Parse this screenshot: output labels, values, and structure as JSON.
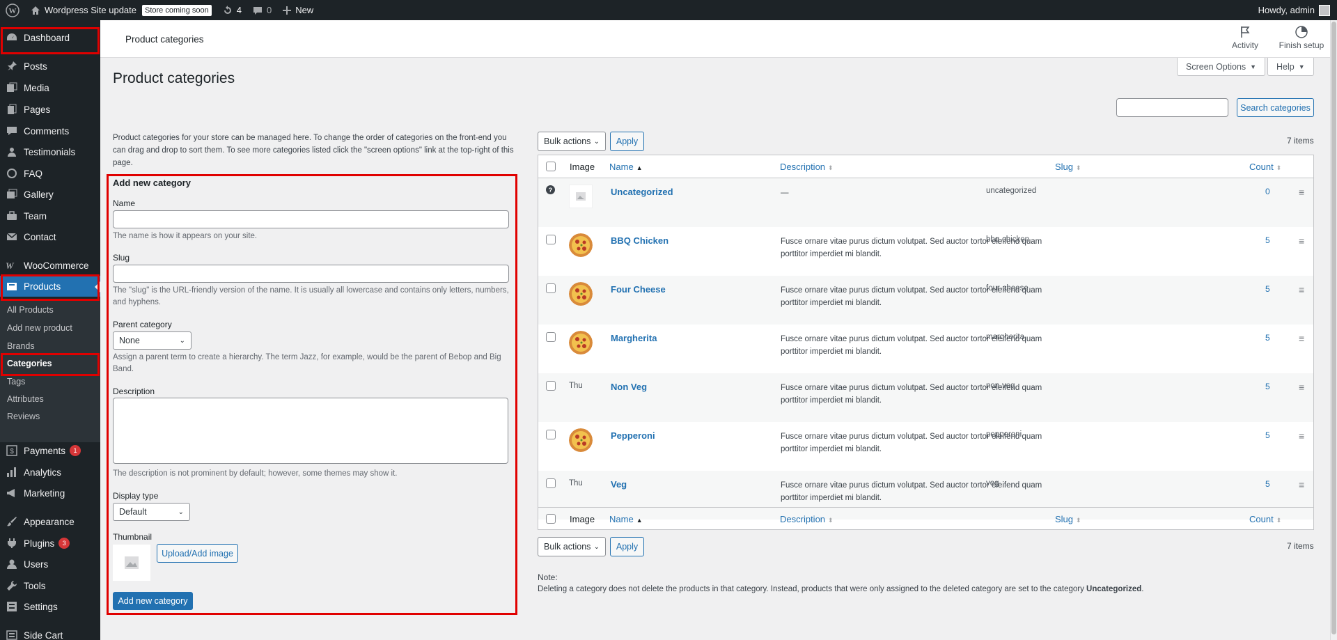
{
  "adminbar": {
    "site_name": "Wordpress Site update",
    "store_badge": "Store coming soon",
    "updates_count": "4",
    "comments_count": "0",
    "new_label": "New",
    "howdy": "Howdy, admin"
  },
  "sidebar": {
    "dashboard": "Dashboard",
    "posts": "Posts",
    "media": "Media",
    "pages": "Pages",
    "comments": "Comments",
    "testimonials": "Testimonials",
    "faq": "FAQ",
    "gallery": "Gallery",
    "team": "Team",
    "contact": "Contact",
    "woocommerce": "WooCommerce",
    "products": "Products",
    "sub": {
      "all_products": "All Products",
      "add_new_product": "Add new product",
      "brands": "Brands",
      "categories": "Categories",
      "tags": "Tags",
      "attributes": "Attributes",
      "reviews": "Reviews"
    },
    "payments": "Payments",
    "payments_badge": "1",
    "analytics": "Analytics",
    "marketing": "Marketing",
    "appearance": "Appearance",
    "plugins": "Plugins",
    "plugins_badge": "3",
    "users": "Users",
    "tools": "Tools",
    "settings": "Settings",
    "side_cart": "Side Cart"
  },
  "header": {
    "title": "Product categories",
    "activity": "Activity",
    "finish_setup": "Finish setup",
    "screen_options": "Screen Options",
    "help": "Help"
  },
  "page": {
    "title": "Product categories",
    "intro": "Product categories for your store can be managed here. To change the order of categories on the front-end you can drag and drop to sort them. To see more categories listed click the \"screen options\" link at the top-right of this page."
  },
  "form": {
    "heading": "Add new category",
    "name_label": "Name",
    "name_hint": "The name is how it appears on your site.",
    "slug_label": "Slug",
    "slug_hint": "The \"slug\" is the URL-friendly version of the name. It is usually all lowercase and contains only letters, numbers, and hyphens.",
    "parent_label": "Parent category",
    "parent_value": "None",
    "parent_hint": "Assign a parent term to create a hierarchy. The term Jazz, for example, would be the parent of Bebop and Big Band.",
    "description_label": "Description",
    "description_hint": "The description is not prominent by default; however, some themes may show it.",
    "display_type_label": "Display type",
    "display_type_value": "Default",
    "thumbnail_label": "Thumbnail",
    "upload_button": "Upload/Add image",
    "submit_button": "Add new category"
  },
  "list": {
    "search_button": "Search categories",
    "bulk_actions": "Bulk actions",
    "apply": "Apply",
    "items_count": "7 items",
    "columns": {
      "image": "Image",
      "name": "Name",
      "description": "Description",
      "slug": "Slug",
      "count": "Count"
    },
    "rows": [
      {
        "name": "Uncategorized",
        "description": "—",
        "slug": "uncategorized",
        "count": "0",
        "image": "placeholder"
      },
      {
        "name": "BBQ Chicken",
        "description": "Fusce ornare vitae purus dictum volutpat. Sed auctor tortor eleifend quam porttitor imperdiet mi blandit.",
        "slug": "bbq-chicken",
        "count": "5",
        "image": "pizza"
      },
      {
        "name": "Four Cheese",
        "description": "Fusce ornare vitae purus dictum volutpat. Sed auctor tortor eleifend quam porttitor imperdiet mi blandit.",
        "slug": "four-cheese",
        "count": "5",
        "image": "pizza"
      },
      {
        "name": "Margherita",
        "description": "Fusce ornare vitae purus dictum volutpat. Sed auctor tortor eleifend quam porttitor imperdiet mi blandit.",
        "slug": "margherita",
        "count": "5",
        "image": "pizza"
      },
      {
        "name": "Non Veg",
        "description": "Fusce ornare vitae purus dictum volutpat. Sed auctor tortor eleifend quam porttitor imperdiet mi blandit.",
        "slug": "non-veg",
        "count": "5",
        "image": "broken",
        "image_alt": "Thu"
      },
      {
        "name": "Pepperoni",
        "description": "Fusce ornare vitae purus dictum volutpat. Sed auctor tortor eleifend quam porttitor imperdiet mi blandit.",
        "slug": "pepperoni",
        "count": "5",
        "image": "pizza"
      },
      {
        "name": "Veg",
        "description": "Fusce ornare vitae purus dictum volutpat. Sed auctor tortor eleifend quam porttitor imperdiet mi blandit.",
        "slug": "veg",
        "count": "5",
        "image": "broken",
        "image_alt": "Thu"
      }
    ]
  },
  "note": {
    "heading": "Note:",
    "text": "Deleting a category does not delete the products in that category. Instead, products that were only assigned to the deleted category are set to the category",
    "category": "Uncategorized",
    "end": "."
  }
}
